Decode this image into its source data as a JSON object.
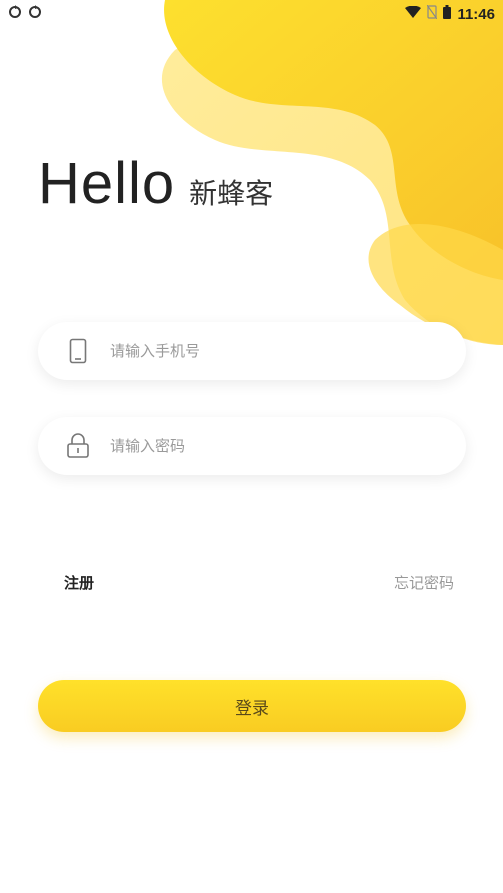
{
  "status_bar": {
    "time": "11:46"
  },
  "greeting": {
    "hello": "Hello",
    "app_name": "新蜂客"
  },
  "form": {
    "phone_placeholder": "请输入手机号",
    "password_placeholder": "请输入密码"
  },
  "links": {
    "register": "注册",
    "forgot_password": "忘记密码"
  },
  "login": {
    "label": "登录"
  },
  "icons": {
    "status_left": [
      "sync-icon",
      "sync-icon"
    ],
    "status_right": [
      "wifi-icon",
      "no-sim-icon",
      "battery-icon"
    ],
    "phone_field": "phone-icon",
    "password_field": "lock-icon"
  },
  "colors": {
    "accent": "#FBCB2A",
    "accent_light": "#FFE27A",
    "text_dark": "#222222",
    "placeholder": "#9A9A9A"
  }
}
